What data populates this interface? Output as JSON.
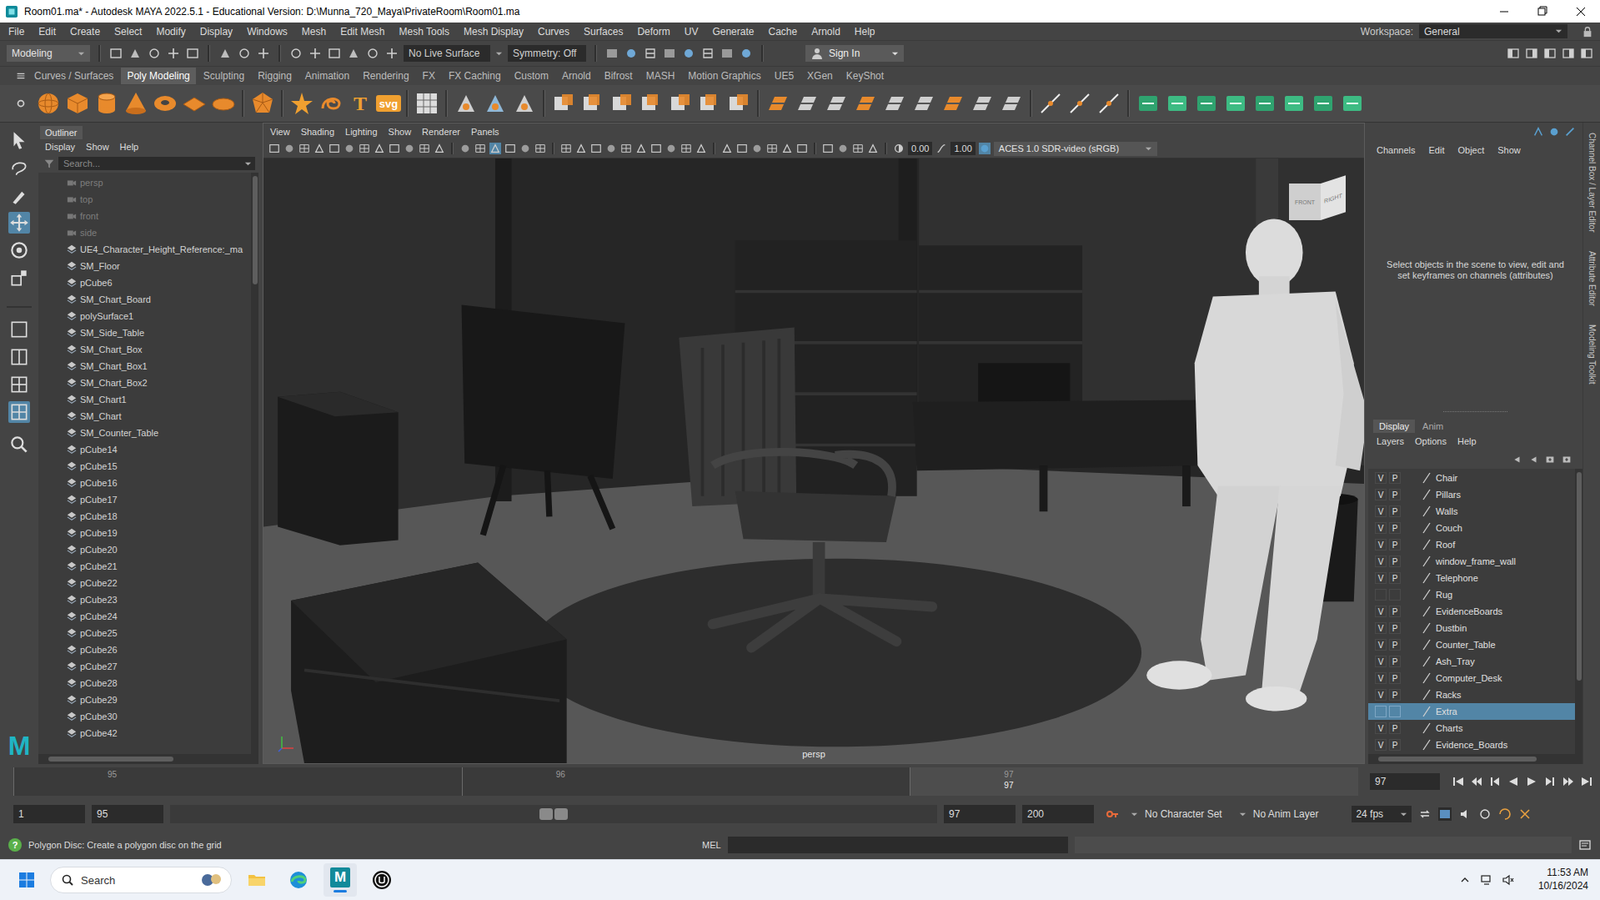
{
  "window": {
    "title": "Room01.ma* - Autodesk MAYA 2022.5.1 - Educational Version: D:\\Munna_720_Maya\\PrivateRoom\\Room01.ma"
  },
  "menu_bar": {
    "items": [
      "File",
      "Edit",
      "Create",
      "Select",
      "Modify",
      "Display",
      "Windows",
      "Mesh",
      "Edit Mesh",
      "Mesh Tools",
      "Mesh Display",
      "Curves",
      "Surfaces",
      "Deform",
      "UV",
      "Generate",
      "Cache",
      "Arnold",
      "Help"
    ],
    "workspace_label": "Workspace:",
    "workspace": "General"
  },
  "status_line": {
    "mode": "Modeling",
    "live_surface": "No Live Surface",
    "symmetry": "Symmetry: Off",
    "sign_in": "Sign In"
  },
  "shelf": {
    "tabs": [
      {
        "label": "Curves / Surfaces",
        "selected": false
      },
      {
        "label": "Poly Modeling",
        "selected": true
      },
      {
        "label": "Sculpting",
        "selected": false
      },
      {
        "label": "Rigging",
        "selected": false
      },
      {
        "label": "Animation",
        "selected": false
      },
      {
        "label": "Rendering",
        "selected": false
      },
      {
        "label": "FX",
        "selected": false
      },
      {
        "label": "FX Caching",
        "selected": false
      },
      {
        "label": "Custom",
        "selected": false
      },
      {
        "label": "Arnold",
        "selected": false
      },
      {
        "label": "Bifrost",
        "selected": false
      },
      {
        "label": "MASH",
        "selected": false
      },
      {
        "label": "Motion Graphics",
        "selected": false
      },
      {
        "label": "UE5",
        "selected": false
      },
      {
        "label": "XGen",
        "selected": false
      },
      {
        "label": "KeyShot",
        "selected": false
      }
    ],
    "glyphs": [
      "T",
      "svg"
    ]
  },
  "toolbox": {
    "logo": "M"
  },
  "outliner": {
    "title": "Outliner",
    "menu": [
      "Display",
      "Show",
      "Help"
    ],
    "search_placeholder": "Search...",
    "items": [
      {
        "label": "persp",
        "kind": "camera",
        "dimmed": true
      },
      {
        "label": "top",
        "kind": "camera",
        "dimmed": true
      },
      {
        "label": "front",
        "kind": "camera",
        "dimmed": true
      },
      {
        "label": "side",
        "kind": "camera",
        "dimmed": true
      },
      {
        "label": "UE4_Character_Height_Reference:_ma",
        "kind": "mesh",
        "dimmed": false
      },
      {
        "label": "SM_Floor",
        "kind": "mesh",
        "dimmed": false
      },
      {
        "label": "pCube6",
        "kind": "mesh",
        "dimmed": false
      },
      {
        "label": "SM_Chart_Board",
        "kind": "mesh",
        "dimmed": false
      },
      {
        "label": "polySurface1",
        "kind": "mesh",
        "dimmed": false
      },
      {
        "label": "SM_Side_Table",
        "kind": "mesh",
        "dimmed": false
      },
      {
        "label": "SM_Chart_Box",
        "kind": "mesh",
        "dimmed": false
      },
      {
        "label": "SM_Chart_Box1",
        "kind": "mesh",
        "dimmed": false
      },
      {
        "label": "SM_Chart_Box2",
        "kind": "mesh",
        "dimmed": false
      },
      {
        "label": "SM_Chart1",
        "kind": "mesh",
        "dimmed": false
      },
      {
        "label": "SM_Chart",
        "kind": "mesh",
        "dimmed": false
      },
      {
        "label": "SM_Counter_Table",
        "kind": "mesh",
        "dimmed": false
      },
      {
        "label": "pCube14",
        "kind": "mesh",
        "dimmed": false
      },
      {
        "label": "pCube15",
        "kind": "mesh",
        "dimmed": false
      },
      {
        "label": "pCube16",
        "kind": "mesh",
        "dimmed": false
      },
      {
        "label": "pCube17",
        "kind": "mesh",
        "dimmed": false
      },
      {
        "label": "pCube18",
        "kind": "mesh",
        "dimmed": false
      },
      {
        "label": "pCube19",
        "kind": "mesh",
        "dimmed": false
      },
      {
        "label": "pCube20",
        "kind": "mesh",
        "dimmed": false
      },
      {
        "label": "pCube21",
        "kind": "mesh",
        "dimmed": false
      },
      {
        "label": "pCube22",
        "kind": "mesh",
        "dimmed": false
      },
      {
        "label": "pCube23",
        "kind": "mesh",
        "dimmed": false
      },
      {
        "label": "pCube24",
        "kind": "mesh",
        "dimmed": false
      },
      {
        "label": "pCube25",
        "kind": "mesh",
        "dimmed": false
      },
      {
        "label": "pCube26",
        "kind": "mesh",
        "dimmed": false
      },
      {
        "label": "pCube27",
        "kind": "mesh",
        "dimmed": false
      },
      {
        "label": "pCube28",
        "kind": "mesh",
        "dimmed": false
      },
      {
        "label": "pCube29",
        "kind": "mesh",
        "dimmed": false
      },
      {
        "label": "pCube30",
        "kind": "mesh",
        "dimmed": false
      },
      {
        "label": "pCube42",
        "kind": "mesh",
        "dimmed": false
      }
    ]
  },
  "viewport": {
    "menu": [
      "View",
      "Shading",
      "Lighting",
      "Show",
      "Renderer",
      "Panels"
    ],
    "exposure": "0.00",
    "gamma": "1.00",
    "color_space": "ACES 1.0 SDR-video (sRGB)",
    "camera": "persp",
    "view_cube": {
      "front": "FRONT",
      "right": "RIGHT"
    }
  },
  "channel_box": {
    "menu": [
      "Channels",
      "Edit",
      "Object",
      "Show"
    ],
    "message": "Select objects in the scene to view, edit and set keyframes on channels (attributes)"
  },
  "side_tabs": [
    "Channel Box / Layer Editor",
    "Attribute Editor",
    "Modeling Toolkit"
  ],
  "layer_editor": {
    "tabs": [
      {
        "label": "Display",
        "selected": true
      },
      {
        "label": "Anim",
        "selected": false
      }
    ],
    "menu": [
      "Layers",
      "Options",
      "Help"
    ],
    "visible_mark": "V",
    "playback_mark": "P",
    "layers": [
      {
        "name": "Chair",
        "visible": true,
        "playback": true,
        "selected": false
      },
      {
        "name": "Pillars",
        "visible": true,
        "playback": true,
        "selected": false
      },
      {
        "name": "Walls",
        "visible": true,
        "playback": true,
        "selected": false
      },
      {
        "name": "Couch",
        "visible": true,
        "playback": true,
        "selected": false
      },
      {
        "name": "Roof",
        "visible": true,
        "playback": true,
        "selected": false
      },
      {
        "name": "window_frame_wall",
        "visible": true,
        "playback": true,
        "selected": false
      },
      {
        "name": "Telephone",
        "visible": true,
        "playback": true,
        "selected": false
      },
      {
        "name": "Rug",
        "visible": false,
        "playback": false,
        "selected": false
      },
      {
        "name": "EvidenceBoards",
        "visible": true,
        "playback": true,
        "selected": false
      },
      {
        "name": "Dustbin",
        "visible": true,
        "playback": true,
        "selected": false
      },
      {
        "name": "Counter_Table",
        "visible": true,
        "playback": true,
        "selected": false
      },
      {
        "name": "Ash_Tray",
        "visible": true,
        "playback": true,
        "selected": false
      },
      {
        "name": "Computer_Desk",
        "visible": true,
        "playback": true,
        "selected": false
      },
      {
        "name": "Racks",
        "visible": true,
        "playback": true,
        "selected": false
      },
      {
        "name": "Extra",
        "visible": false,
        "playback": false,
        "selected": true
      },
      {
        "name": "Charts",
        "visible": true,
        "playback": true,
        "selected": false
      },
      {
        "name": "Evidence_Boards",
        "visible": true,
        "playback": true,
        "selected": false
      }
    ]
  },
  "time_slider": {
    "frames": [
      {
        "label": "95",
        "current": false
      },
      {
        "label": "96",
        "current": false
      },
      {
        "label": "97",
        "current": true
      }
    ],
    "current_label": "97",
    "current_frame": "97"
  },
  "range_slider": {
    "start": "1",
    "range_start": "95",
    "range_end": "97",
    "end": "200",
    "character_set": "No Character Set",
    "anim_layer": "No Anim Layer",
    "fps": "24 fps"
  },
  "help_line": {
    "icon": "?",
    "text": "Polygon Disc: Create a polygon disc on the grid"
  },
  "command_line": {
    "language": "MEL"
  },
  "taskbar": {
    "search": "Search",
    "maya_logo": "M",
    "time": "11:53 AM",
    "date": "10/16/2024"
  }
}
